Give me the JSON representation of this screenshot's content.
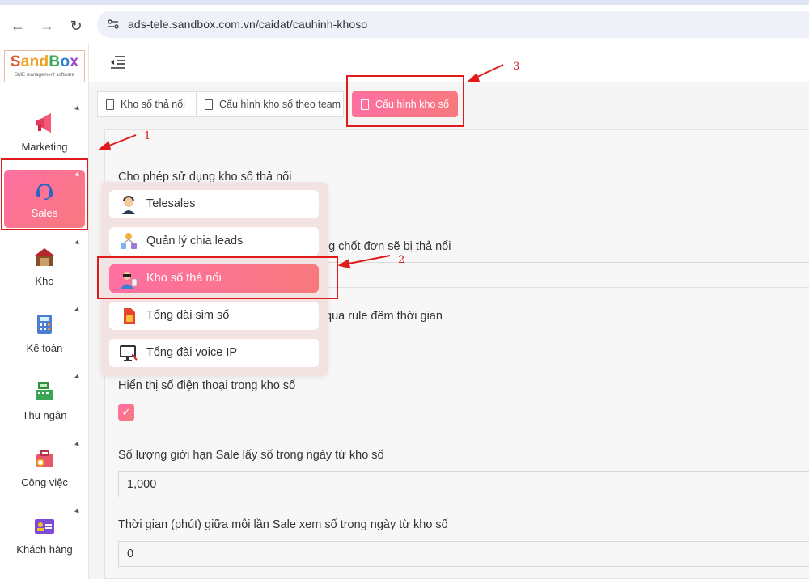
{
  "browser": {
    "url": "ads-tele.sandbox.com.vn/caidat/cauhinh-khoso",
    "back_icon": "←",
    "forward_icon": "→",
    "reload_icon": "↻",
    "site_icon": "⚙"
  },
  "logo": {
    "title_parts": [
      "S",
      "and",
      "B",
      "o",
      "x"
    ],
    "subtitle": "SME management software"
  },
  "sidebar": {
    "items": [
      {
        "label": "Marketing",
        "icon": "megaphone-icon"
      },
      {
        "label": "Sales",
        "icon": "headset-icon",
        "active": true
      },
      {
        "label": "Kho",
        "icon": "warehouse-icon"
      },
      {
        "label": "Kế toán",
        "icon": "calculator-icon"
      },
      {
        "label": "Thu ngân",
        "icon": "cash-register-icon"
      },
      {
        "label": "Công việc",
        "icon": "briefcase-icon"
      },
      {
        "label": "Khách hàng",
        "icon": "contact-card-icon"
      }
    ]
  },
  "tabs": [
    {
      "label": "Kho số thả nổi"
    },
    {
      "label": "Cấu hình kho số theo team"
    },
    {
      "label": "Cấu hình kho số",
      "active": true
    }
  ],
  "form": {
    "f1_label": "Cho phép sử dụng kho số thả nổi",
    "f2_label": "Số ngày không chốt đơn sẽ bị thả nổi",
    "f2_label_visible": "ng chốt đơn sẽ bị thả nổi",
    "f3_label_visible": "qua rule đếm thời gian",
    "f4_label": "Hiển thị số điện thoại trong kho số",
    "f4_checked": "✓",
    "f5_label": "Số lượng giới hạn Sale lấy số trong ngày từ kho số",
    "f5_value": "1,000",
    "f6_label": "Thời gian (phút) giữa mỗi lần Sale xem số trong ngày từ kho số",
    "f6_value": "0"
  },
  "dropdown": {
    "items": [
      {
        "label": "Telesales",
        "icon": "telesales-icon"
      },
      {
        "label": "Quản lý chia leads",
        "icon": "leads-icon"
      },
      {
        "label": "Kho số thả nổi",
        "icon": "floating-numbers-icon",
        "active": true
      },
      {
        "label": "Tổng đài sim số",
        "icon": "sim-card-icon"
      },
      {
        "label": "Tổng đài voice IP",
        "icon": "voip-icon"
      }
    ]
  },
  "annotations": {
    "n1": "1",
    "n2": "2",
    "n3": "3",
    "color": "#e01b1b"
  },
  "colors": {
    "accent_start": "#ff6fa3",
    "accent_end": "#f7797d"
  }
}
